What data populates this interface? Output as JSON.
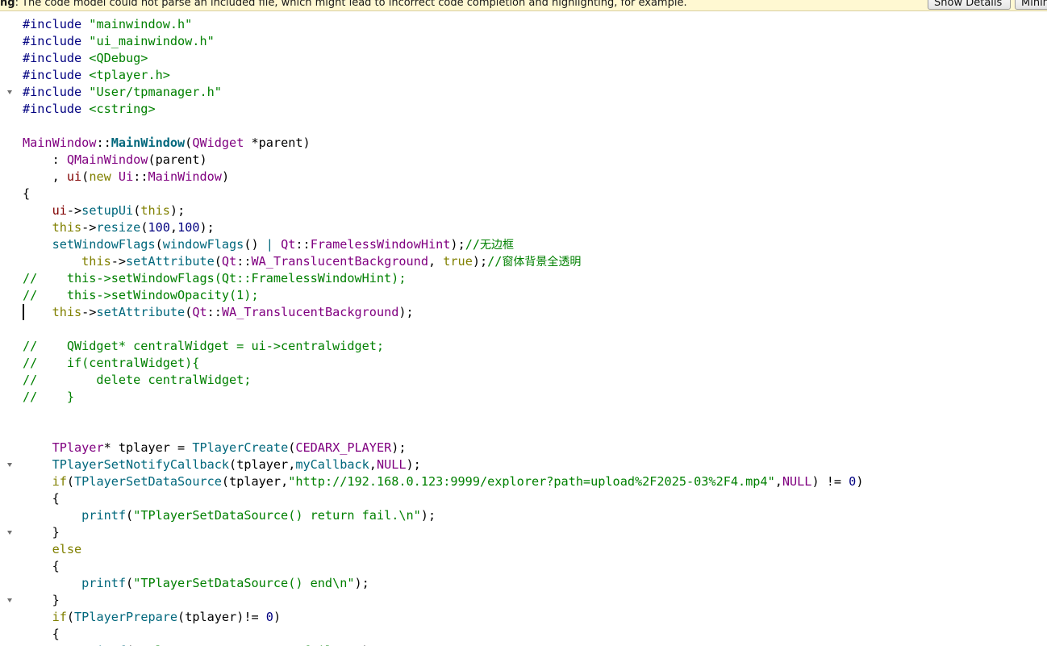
{
  "warning": {
    "prefix": "ng",
    "message": ": The code model could not parse an included file, which might lead to incorrect code completion and highlighting, for example.",
    "show_details_label": "Show Details",
    "minimize_label": "Minimize"
  },
  "editor": {
    "fold_markers": [
      5,
      27,
      31,
      35
    ],
    "cursor_line": 18,
    "lines": [
      [
        [
          "preproc",
          "#include "
        ],
        [
          "string",
          "\"mainwindow.h\""
        ]
      ],
      [
        [
          "preproc",
          "#include "
        ],
        [
          "string",
          "\"ui_mainwindow.h\""
        ]
      ],
      [
        [
          "preproc",
          "#include "
        ],
        [
          "string",
          "<QDebug>"
        ]
      ],
      [
        [
          "preproc",
          "#include "
        ],
        [
          "string",
          "<tplayer.h>"
        ]
      ],
      [
        [
          "preproc",
          "#include "
        ],
        [
          "string",
          "\"User/tpmanager.h\""
        ]
      ],
      [
        [
          "preproc",
          "#include "
        ],
        [
          "string",
          "<cstring>"
        ]
      ],
      [],
      [
        [
          "class",
          "MainWindow"
        ],
        [
          "op",
          "::"
        ],
        [
          "funcdef",
          "MainWindow"
        ],
        [
          "op",
          "("
        ],
        [
          "class",
          "QWidget"
        ],
        [
          "op",
          " *"
        ],
        [
          "plain",
          "parent"
        ],
        [
          "op",
          ")"
        ]
      ],
      [
        [
          "op",
          "    : "
        ],
        [
          "class",
          "QMainWindow"
        ],
        [
          "op",
          "("
        ],
        [
          "plain",
          "parent"
        ],
        [
          "op",
          ")"
        ]
      ],
      [
        [
          "op",
          "    , "
        ],
        [
          "field",
          "ui"
        ],
        [
          "op",
          "("
        ],
        [
          "keyword",
          "new"
        ],
        [
          "op",
          " "
        ],
        [
          "class",
          "Ui"
        ],
        [
          "op",
          "::"
        ],
        [
          "class",
          "MainWindow"
        ],
        [
          "op",
          ")"
        ]
      ],
      [
        [
          "op",
          "{"
        ]
      ],
      [
        [
          "plain",
          "    "
        ],
        [
          "field",
          "ui"
        ],
        [
          "op",
          "->"
        ],
        [
          "func",
          "setupUi"
        ],
        [
          "op",
          "("
        ],
        [
          "keyword",
          "this"
        ],
        [
          "op",
          ");"
        ]
      ],
      [
        [
          "plain",
          "    "
        ],
        [
          "keyword",
          "this"
        ],
        [
          "op",
          "->"
        ],
        [
          "func",
          "resize"
        ],
        [
          "op",
          "("
        ],
        [
          "number",
          "100"
        ],
        [
          "op",
          ","
        ],
        [
          "number",
          "100"
        ],
        [
          "op",
          ");"
        ]
      ],
      [
        [
          "plain",
          "    "
        ],
        [
          "func",
          "setWindowFlags"
        ],
        [
          "op",
          "("
        ],
        [
          "func",
          "windowFlags"
        ],
        [
          "op",
          "() "
        ],
        [
          "func",
          "|"
        ],
        [
          "op",
          " "
        ],
        [
          "class",
          "Qt"
        ],
        [
          "op",
          "::"
        ],
        [
          "macro",
          "FramelessWindowHint"
        ],
        [
          "op",
          ");"
        ],
        [
          "comment",
          "//"
        ],
        [
          "comment-cn",
          "无边框"
        ]
      ],
      [
        [
          "plain",
          "        "
        ],
        [
          "keyword",
          "this"
        ],
        [
          "op",
          "->"
        ],
        [
          "func",
          "setAttribute"
        ],
        [
          "op",
          "("
        ],
        [
          "class",
          "Qt"
        ],
        [
          "op",
          "::"
        ],
        [
          "macro",
          "WA_TranslucentBackground"
        ],
        [
          "op",
          ", "
        ],
        [
          "keyword",
          "true"
        ],
        [
          "op",
          ");"
        ],
        [
          "comment",
          "//"
        ],
        [
          "comment-cn",
          "窗体背景全透明"
        ]
      ],
      [
        [
          "comment",
          "//    this->setWindowFlags(Qt::FramelessWindowHint);"
        ]
      ],
      [
        [
          "comment",
          "//    this->setWindowOpacity(1);"
        ]
      ],
      [
        [
          "plain",
          "    "
        ],
        [
          "keyword",
          "this"
        ],
        [
          "op",
          "->"
        ],
        [
          "func",
          "setAttribute"
        ],
        [
          "op",
          "("
        ],
        [
          "class",
          "Qt"
        ],
        [
          "op",
          "::"
        ],
        [
          "macro",
          "WA_TranslucentBackground"
        ],
        [
          "op",
          ");"
        ]
      ],
      [],
      [
        [
          "comment",
          "//    QWidget* centralWidget = ui->centralwidget;"
        ]
      ],
      [
        [
          "comment",
          "//    if(centralWidget){"
        ]
      ],
      [
        [
          "comment",
          "//        delete centralWidget;"
        ]
      ],
      [
        [
          "comment",
          "//    }"
        ]
      ],
      [],
      [],
      [
        [
          "plain",
          "    "
        ],
        [
          "class",
          "TPlayer"
        ],
        [
          "op",
          "* "
        ],
        [
          "plain",
          "tplayer"
        ],
        [
          "op",
          " = "
        ],
        [
          "func",
          "TPlayerCreate"
        ],
        [
          "op",
          "("
        ],
        [
          "macro",
          "CEDARX_PLAYER"
        ],
        [
          "op",
          ");"
        ]
      ],
      [
        [
          "plain",
          "    "
        ],
        [
          "func",
          "TPlayerSetNotifyCallback"
        ],
        [
          "op",
          "("
        ],
        [
          "plain",
          "tplayer"
        ],
        [
          "op",
          ","
        ],
        [
          "func",
          "myCallback"
        ],
        [
          "op",
          ","
        ],
        [
          "macro",
          "NULL"
        ],
        [
          "op",
          ");"
        ]
      ],
      [
        [
          "plain",
          "    "
        ],
        [
          "keyword",
          "if"
        ],
        [
          "op",
          "("
        ],
        [
          "func",
          "TPlayerSetDataSource"
        ],
        [
          "op",
          "("
        ],
        [
          "plain",
          "tplayer"
        ],
        [
          "op",
          ","
        ],
        [
          "string",
          "\"http://192.168.0.123:9999/explorer?path=upload%2F2025-03%2F4.mp4\""
        ],
        [
          "op",
          ","
        ],
        [
          "macro",
          "NULL"
        ],
        [
          "op",
          ") != "
        ],
        [
          "number",
          "0"
        ],
        [
          "op",
          ")"
        ]
      ],
      [
        [
          "op",
          "    {"
        ]
      ],
      [
        [
          "plain",
          "        "
        ],
        [
          "func",
          "printf"
        ],
        [
          "op",
          "("
        ],
        [
          "string",
          "\"TPlayerSetDataSource() return fail.\\n\""
        ],
        [
          "op",
          ");"
        ]
      ],
      [
        [
          "op",
          "    }"
        ]
      ],
      [
        [
          "plain",
          "    "
        ],
        [
          "keyword",
          "else"
        ]
      ],
      [
        [
          "op",
          "    {"
        ]
      ],
      [
        [
          "plain",
          "        "
        ],
        [
          "func",
          "printf"
        ],
        [
          "op",
          "("
        ],
        [
          "string",
          "\"TPlayerSetDataSource() end\\n\""
        ],
        [
          "op",
          ");"
        ]
      ],
      [
        [
          "op",
          "    }"
        ]
      ],
      [
        [
          "plain",
          "    "
        ],
        [
          "keyword",
          "if"
        ],
        [
          "op",
          "("
        ],
        [
          "func",
          "TPlayerPrepare"
        ],
        [
          "op",
          "("
        ],
        [
          "plain",
          "tplayer"
        ],
        [
          "op",
          ")!= "
        ],
        [
          "number",
          "0"
        ],
        [
          "op",
          ")"
        ]
      ],
      [
        [
          "op",
          "    {"
        ]
      ],
      [
        [
          "plain",
          "        "
        ],
        [
          "func",
          "printf"
        ],
        [
          "op",
          "("
        ],
        [
          "string",
          "\"TPlayerPrepare return fail.\\n\""
        ],
        [
          "op",
          ");"
        ]
      ]
    ]
  }
}
